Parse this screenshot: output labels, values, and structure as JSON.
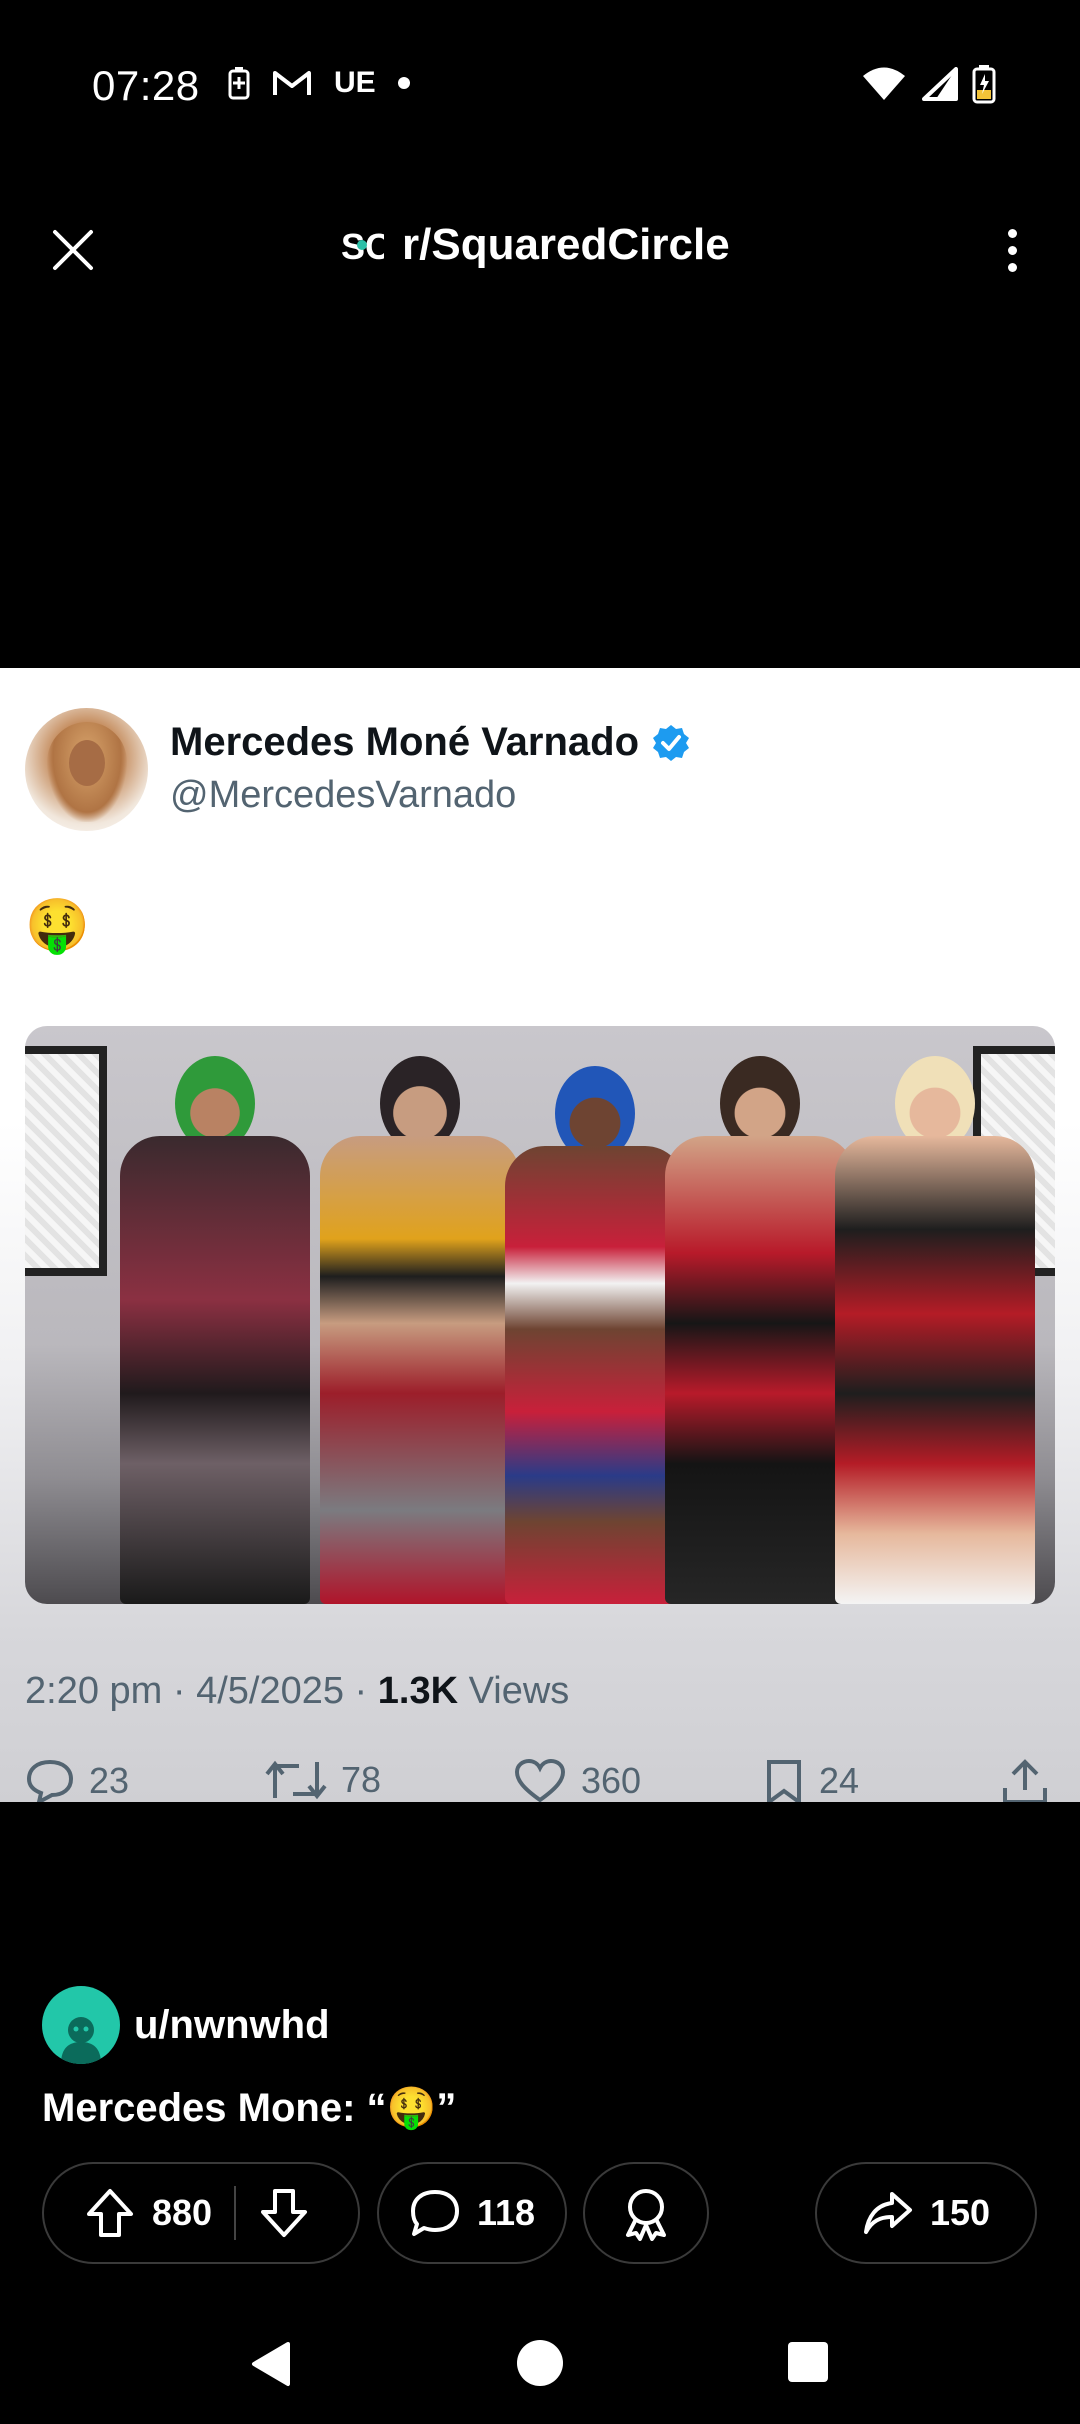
{
  "status_bar": {
    "time": "07:28",
    "carrier": "UE"
  },
  "header": {
    "subreddit": "r/SquaredCircle"
  },
  "tweet": {
    "display_name": "Mercedes Moné Varnado",
    "handle": "@MercedesVarnado",
    "text": "🤑",
    "time": "2:20 pm · 4/5/2025 · ",
    "views_count": "1.3K",
    "views_label": " Views",
    "replies": "23",
    "retweets": "78",
    "likes": "360",
    "bookmarks": "24"
  },
  "post": {
    "author": "u/nwnwhd",
    "title": "Mercedes Mone: “🤑”",
    "upvotes": "880",
    "comments": "118",
    "shares": "150"
  },
  "colors": {
    "verified": "#1d9bf0",
    "author_avatar": "#22c7a9"
  }
}
